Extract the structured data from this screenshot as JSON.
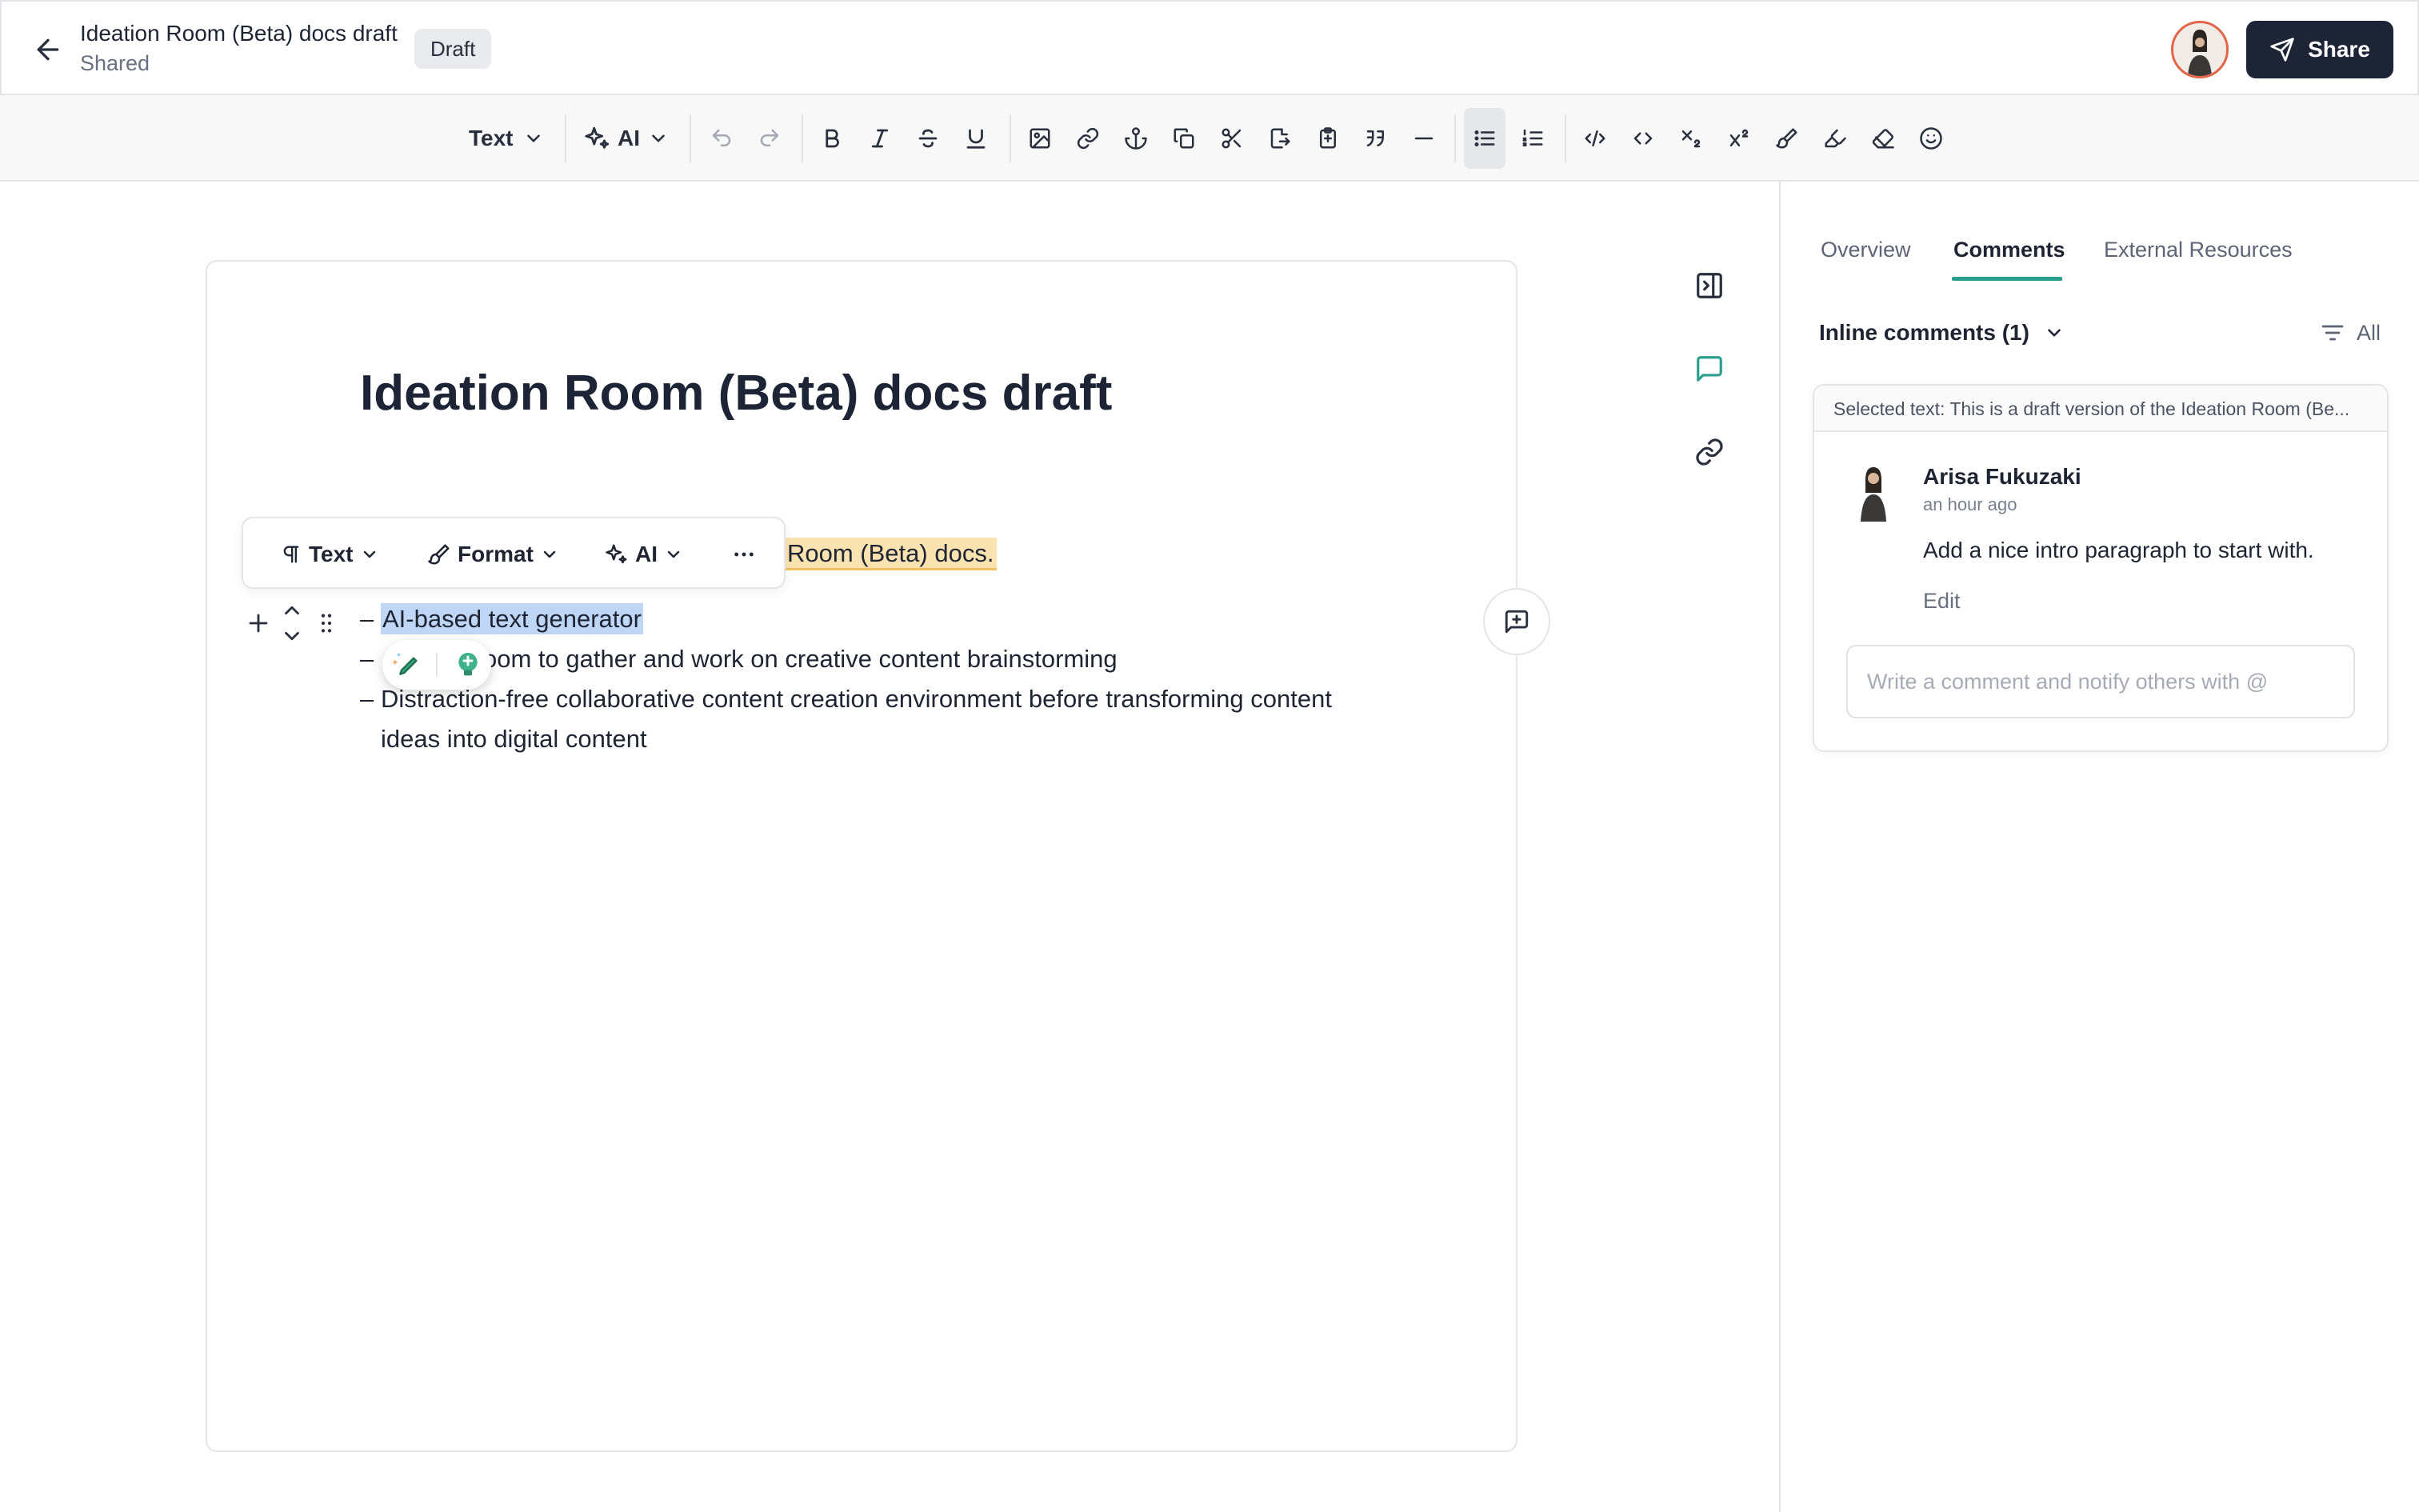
{
  "header": {
    "doc_title": "Ideation Room (Beta) docs draft",
    "doc_subtitle": "Shared",
    "status_badge": "Draft",
    "share_label": "Share"
  },
  "toolbar": {
    "text_style_label": "Text",
    "ai_label": "AI",
    "icons": [
      "undo-icon",
      "redo-icon",
      "bold-icon",
      "italic-icon",
      "strikethrough-icon",
      "underline-icon",
      "image-icon",
      "link-icon",
      "anchor-icon",
      "copy-icon",
      "cut-icon",
      "export-icon",
      "paste-icon",
      "blockquote-icon",
      "horizontal-rule-icon",
      "bullet-list-icon",
      "numbered-list-icon",
      "code-block-icon",
      "inline-code-icon",
      "subscript-icon",
      "superscript-icon",
      "brush-icon",
      "highlighter-icon",
      "eraser-icon",
      "emoji-icon"
    ],
    "active_item": "bullet-list-icon"
  },
  "editor": {
    "heading": "Ideation Room (Beta) docs draft",
    "highlighted_text": "Room (Beta) docs.",
    "floating_toolbar": {
      "text_label": "Text",
      "format_label": "Format",
      "ai_label": "AI"
    },
    "bullets": [
      {
        "dash": "–",
        "text": "AI-based text generator"
      },
      {
        "dash": "–",
        "text": "oom to gather and work on creative content brainstorming"
      },
      {
        "dash": "–",
        "text": "Distraction-free collaborative content creation environment before transforming content"
      },
      {
        "dash": "",
        "text": "ideas into digital content"
      }
    ]
  },
  "panel": {
    "tabs": [
      {
        "label": "Overview"
      },
      {
        "label": "Comments"
      },
      {
        "label": "External Resources"
      }
    ],
    "active_tab": "Comments",
    "inline_comments_label": "Inline comments (1)",
    "filter_label": "All",
    "comment": {
      "selected_text": "Selected text: This is a draft version of the Ideation Room (Be...",
      "author": "Arisa Fukuzaki",
      "time": "an hour ago",
      "body": "Add a nice intro paragraph to start with.",
      "edit_label": "Edit",
      "input_placeholder": "Write a comment and notify others with @"
    }
  },
  "colors": {
    "accent": "#2b9e8e",
    "share_button": "#1c2436",
    "selection": "#bfd6f6",
    "highlight": "#fbe3b1"
  }
}
